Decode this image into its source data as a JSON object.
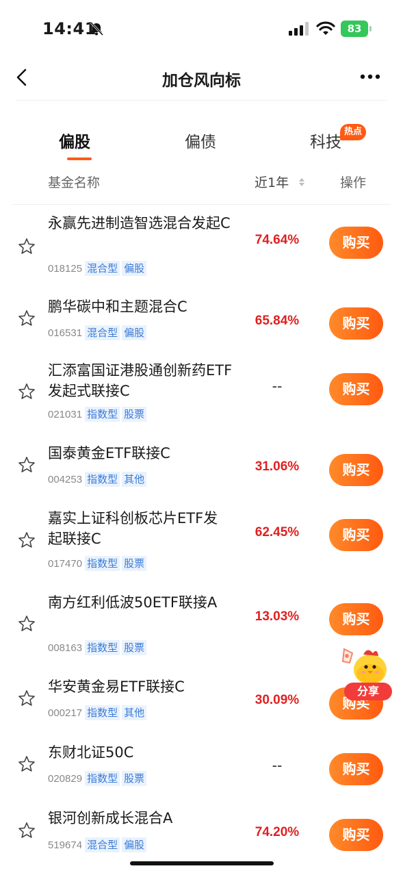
{
  "status_bar": {
    "time": "14:41",
    "battery": "83"
  },
  "header": {
    "title": "加仓风向标"
  },
  "tabs": [
    {
      "label": "偏股",
      "active": true
    },
    {
      "label": "偏债",
      "active": false
    },
    {
      "label": "科技",
      "active": false,
      "badge": "热点"
    }
  ],
  "columns": {
    "name": "基金名称",
    "return": "近1年",
    "action": "操作"
  },
  "funds": [
    {
      "name": "永赢先进制造智选混合发起C",
      "code": "018125",
      "tags": [
        "混合型",
        "偏股"
      ],
      "return": "74.64%"
    },
    {
      "name": "鹏华碳中和主题混合C",
      "code": "016531",
      "tags": [
        "混合型",
        "偏股"
      ],
      "return": "65.84%"
    },
    {
      "name": "汇添富国证港股通创新药ETF发起式联接C",
      "code": "021031",
      "tags": [
        "指数型",
        "股票"
      ],
      "return": "--"
    },
    {
      "name": "国泰黄金ETF联接C",
      "code": "004253",
      "tags": [
        "指数型",
        "其他"
      ],
      "return": "31.06%"
    },
    {
      "name": "嘉实上证科创板芯片ETF发起联接C",
      "code": "017470",
      "tags": [
        "指数型",
        "股票"
      ],
      "return": "62.45%"
    },
    {
      "name": "南方红利低波50ETF联接A",
      "code": "008163",
      "tags": [
        "指数型",
        "股票"
      ],
      "return": "13.03%"
    },
    {
      "name": "华安黄金易ETF联接C",
      "code": "000217",
      "tags": [
        "指数型",
        "其他"
      ],
      "return": "30.09%"
    },
    {
      "name": "东财北证50C",
      "code": "020829",
      "tags": [
        "指数型",
        "股票"
      ],
      "return": "--"
    },
    {
      "name": "银河创新成长混合A",
      "code": "519674",
      "tags": [
        "混合型",
        "偏股"
      ],
      "return": "74.20%"
    }
  ],
  "buy_label": "购买",
  "share_label": "分享",
  "colors": {
    "accent": "#ff5a14",
    "positive": "#e02020",
    "tag_text": "#3a7bd5",
    "tag_bg": "#eaf2fd"
  }
}
